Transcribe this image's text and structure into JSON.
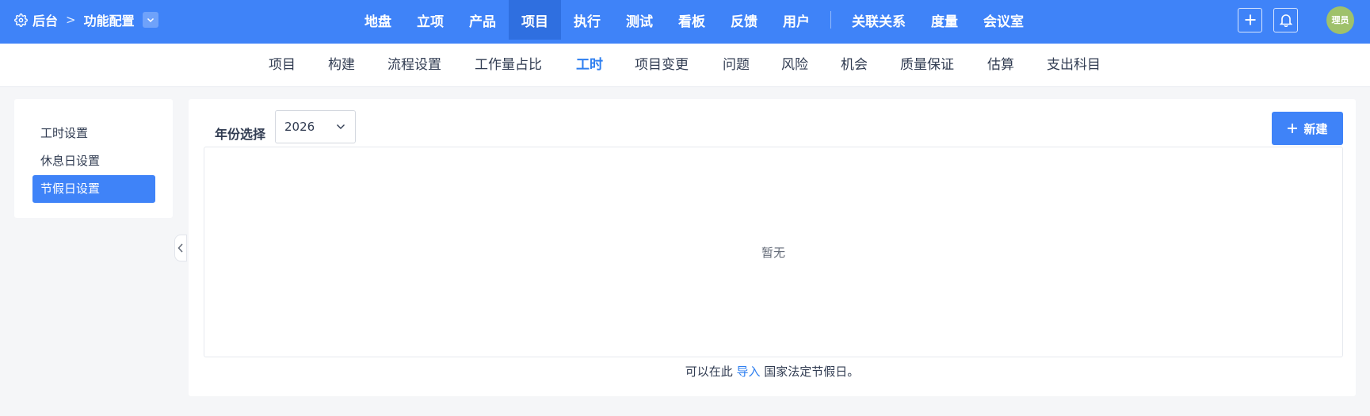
{
  "header": {
    "brand_label": "后台",
    "breadcrumb_separator": ">",
    "section_label": "功能配置",
    "main_nav": [
      {
        "label": "地盘"
      },
      {
        "label": "立项"
      },
      {
        "label": "产品"
      },
      {
        "label": "项目",
        "active": true
      },
      {
        "label": "执行"
      },
      {
        "label": "测试"
      },
      {
        "label": "看板"
      },
      {
        "label": "反馈"
      },
      {
        "label": "用户"
      },
      {
        "label": "关联关系"
      },
      {
        "label": "度量"
      },
      {
        "label": "会议室"
      }
    ],
    "avatar_text": "理员",
    "colors": {
      "primary": "#3f83f8",
      "active_nav": "#2f6fe0"
    }
  },
  "subnav": {
    "items": [
      "项目",
      "构建",
      "流程设置",
      "工作量占比",
      "工时",
      "项目变更",
      "问题",
      "风险",
      "机会",
      "质量保证",
      "估算",
      "支出科目"
    ],
    "active": "工时"
  },
  "sidebar": {
    "items": [
      "工时设置",
      "休息日设置",
      "节假日设置"
    ],
    "active": "节假日设置"
  },
  "main": {
    "year_label": "年份选择",
    "year_value": "2026",
    "new_button_label": "新建",
    "empty_text": "暂无",
    "footer_prefix": "可以在此",
    "footer_link": "导入",
    "footer_suffix": "国家法定节假日。"
  }
}
